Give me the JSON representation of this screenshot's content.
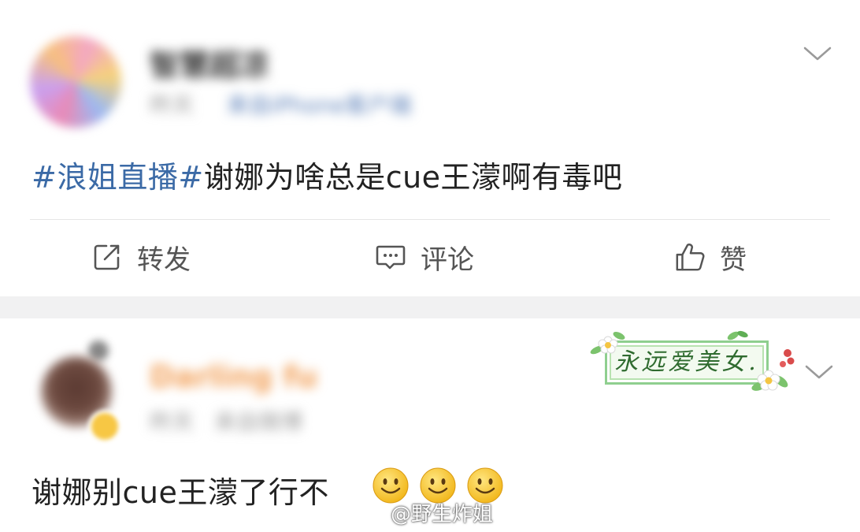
{
  "post1": {
    "author_name": "智慧超凉",
    "meta_time": "昨天",
    "meta_source": "来自iPhone客户端",
    "topic": "#浪姐直播#",
    "text": "谢娜为啥总是cue王濛啊有毒吧",
    "actions": {
      "repost_label": "转发",
      "comment_label": "评论",
      "like_label": "赞"
    }
  },
  "post2": {
    "author_name": "Darling fu",
    "meta_time": "昨天",
    "meta_source": "来自微博",
    "sticker_text": "永远爱美女.",
    "text": "谢娜别cue王濛了行不",
    "emojis": [
      "smile-emoji",
      "smile-emoji",
      "smile-emoji"
    ]
  },
  "watermark": "@野生炸姐",
  "colors": {
    "topic_blue": "#3b6aa6",
    "separator_gray": "#f1f1f2",
    "sticker_green": "#8fcf8f"
  },
  "icons": [
    "repost-icon",
    "comment-icon",
    "like-icon",
    "chevron-down-icon",
    "weibo-logo-icon"
  ]
}
